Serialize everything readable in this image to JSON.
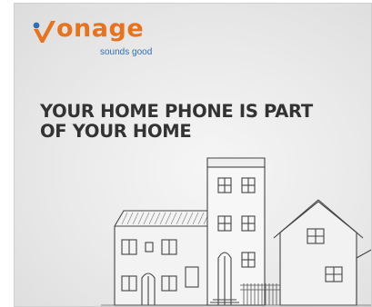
{
  "brand": {
    "name": "Vonage",
    "word_rest": "onage",
    "tagline": "sounds good",
    "mark_icon": "vonage-v-logo-icon",
    "colors": {
      "orange": "#e8731f",
      "blue": "#2f6fb3",
      "text": "#333333"
    }
  },
  "headline": {
    "line1": "YOUR HOME PHONE IS PART",
    "line2": "OF YOUR HOME"
  },
  "illustration": {
    "icon": "house-sketch-illustration"
  }
}
